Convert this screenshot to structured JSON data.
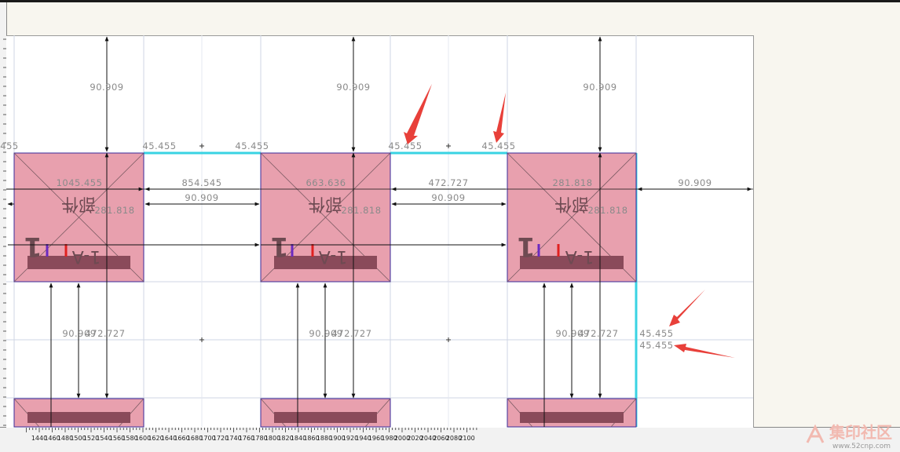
{
  "ruler": {
    "x_ticks": [
      "1440",
      "1460",
      "1480",
      "1500",
      "1520",
      "1540",
      "1560",
      "1580",
      "1600",
      "1620",
      "1640",
      "1660",
      "1680",
      "1700",
      "1720",
      "1740",
      "1760",
      "1780",
      "1800",
      "1820",
      "1840",
      "1860",
      "1880",
      "1900",
      "1920",
      "1940",
      "1960",
      "1980",
      "2000",
      "2020",
      "2040",
      "2060",
      "2080",
      "2100"
    ]
  },
  "dims": {
    "top_height": "90.909",
    "spacing": [
      "45.455",
      "45.455",
      "45.455",
      "45.455",
      "45.455",
      "45.455"
    ],
    "gap": "90.909",
    "right_gap": "90.909",
    "dist_1": "1045.455",
    "dist_2": "663.636",
    "dist_3": "281.818",
    "span_1": "854.545",
    "span_2": "472.727",
    "inner": "281.818",
    "bottom_a": "90.909",
    "bottom_b": "472.727",
    "right_a": "45.455",
    "right_b": "45.455"
  },
  "part": {
    "number": "1",
    "name": "部件",
    "code": "1-A"
  },
  "colors": {
    "part_fill": "#e8a0ae",
    "part_stripe": "#8a4a5a",
    "part_border": "#3a2a9a",
    "highlight_edge": "#39d3e3",
    "arrow_red": "#e8403a",
    "mark_purple": "#6a2ac0",
    "mark_red": "#e02020"
  },
  "watermark": {
    "text": "集印社区",
    "url": "www.52cnp.com"
  }
}
